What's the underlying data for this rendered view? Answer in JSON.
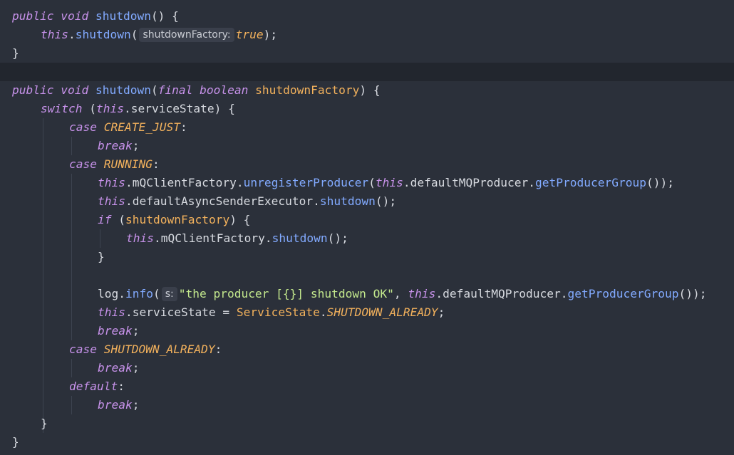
{
  "colors": {
    "background": "#2b303a",
    "keyword": "#c792ea",
    "constant": "#f2b15c",
    "method": "#82aaff",
    "string": "#c3e88d",
    "text": "#d7dae0",
    "hint_background": "#3a3f4b"
  },
  "code": {
    "l1": {
      "t1": "public",
      "t2": " ",
      "t3": "void",
      "t4": " ",
      "t5": "shutdown",
      "t6": "() {"
    },
    "l2": {
      "t1": "this",
      "t2": ".",
      "t3": "shutdown",
      "t4": "(",
      "hint": "shutdownFactory:",
      "t5": "true",
      "t6": ");"
    },
    "l3": {
      "t1": "}"
    },
    "l4": {
      "t1": "public",
      "t2": " ",
      "t3": "void",
      "t4": " ",
      "t5": "shutdown",
      "t6": "(",
      "t7": "final",
      "t8": " ",
      "t9": "boolean",
      "t10": " ",
      "t11": "shutdownFactory",
      "t12": ") {"
    },
    "l5": {
      "t1": "switch",
      "t2": " (",
      "t3": "this",
      "t4": ".serviceState) {"
    },
    "l6": {
      "t1": "case",
      "t2": " ",
      "t3": "CREATE_JUST",
      "t4": ":"
    },
    "l7": {
      "t1": "break",
      "t2": ";"
    },
    "l8": {
      "t1": "case",
      "t2": " ",
      "t3": "RUNNING",
      "t4": ":"
    },
    "l9": {
      "t1": "this",
      "t2": ".mQClientFactory.",
      "t3": "unregisterProducer",
      "t4": "(",
      "t5": "this",
      "t6": ".defaultMQProducer.",
      "t7": "getProducerGroup",
      "t8": "());"
    },
    "l10": {
      "t1": "this",
      "t2": ".defaultAsyncSenderExecutor.",
      "t3": "shutdown",
      "t4": "();"
    },
    "l11": {
      "t1": "if",
      "t2": " (",
      "t3": "shutdownFactory",
      "t4": ") {"
    },
    "l12": {
      "t1": "this",
      "t2": ".mQClientFactory.",
      "t3": "shutdown",
      "t4": "();"
    },
    "l13": {
      "t1": "}"
    },
    "l14": {
      "t1": "log.",
      "t2": "info",
      "t3": "(",
      "hint": "s:",
      "t4": "\"the producer [{}] shutdown OK\"",
      "t5": ", ",
      "t6": "this",
      "t7": ".defaultMQProducer.",
      "t8": "getProducerGroup",
      "t9": "());"
    },
    "l15": {
      "t1": "this",
      "t2": ".serviceState = ",
      "t3": "ServiceState",
      "t4": ".",
      "t5": "SHUTDOWN_ALREADY",
      "t6": ";"
    },
    "l16": {
      "t1": "break",
      "t2": ";"
    },
    "l17": {
      "t1": "case",
      "t2": " ",
      "t3": "SHUTDOWN_ALREADY",
      "t4": ":"
    },
    "l18": {
      "t1": "break",
      "t2": ";"
    },
    "l19": {
      "t1": "default",
      "t2": ":"
    },
    "l20": {
      "t1": "break",
      "t2": ";"
    },
    "l21": {
      "t1": "}"
    },
    "l22": {
      "t1": "}"
    }
  }
}
